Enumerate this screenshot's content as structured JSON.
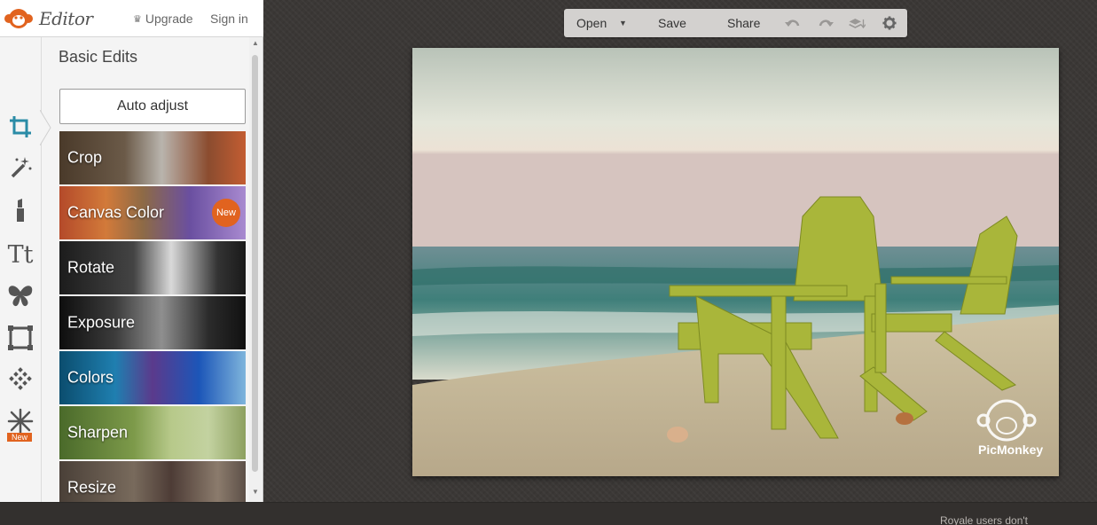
{
  "header": {
    "app_name": "Editor",
    "upgrade_label": "Upgrade",
    "signin_label": "Sign in"
  },
  "tools": [
    {
      "name": "crop-tool-icon"
    },
    {
      "name": "magic-wand-icon"
    },
    {
      "name": "touch-up-lipstick-icon"
    },
    {
      "name": "text-icon",
      "label": "Tt"
    },
    {
      "name": "butterfly-overlay-icon"
    },
    {
      "name": "frame-icon"
    },
    {
      "name": "texture-icon"
    },
    {
      "name": "snowflake-theme-icon",
      "badge": "New"
    }
  ],
  "panel": {
    "title": "Basic Edits",
    "auto_adjust_label": "Auto adjust",
    "edits": [
      {
        "label": "Crop"
      },
      {
        "label": "Canvas Color",
        "badge": "New"
      },
      {
        "label": "Rotate"
      },
      {
        "label": "Exposure"
      },
      {
        "label": "Colors"
      },
      {
        "label": "Sharpen"
      },
      {
        "label": "Resize"
      }
    ]
  },
  "toolbar": {
    "open_label": "Open",
    "save_label": "Save",
    "share_label": "Share"
  },
  "watermark": {
    "text": "PicMonkey"
  },
  "footer": {
    "note": "Royale users don't"
  },
  "colors": {
    "accent": "#e1631f",
    "workspace": "#3b3836",
    "panel": "#f4f4f4",
    "toolbar": "#d3d1cf"
  }
}
